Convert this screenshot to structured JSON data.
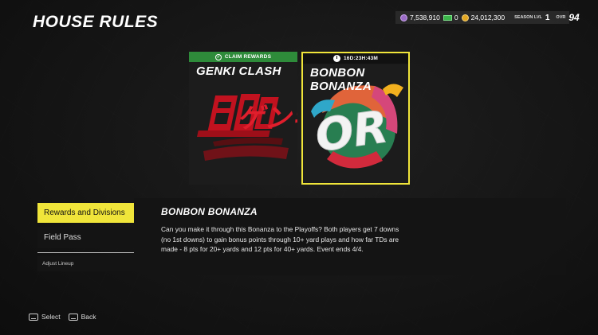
{
  "page": {
    "title": "HOUSE RULES"
  },
  "stats": {
    "coins_purple": "7,538,910",
    "cash": "0",
    "coins_gold": "24,012,300",
    "season_lvl_label": "SEASON LVL",
    "season_lvl": "1",
    "ovr_label": "OVR",
    "ovr": "94"
  },
  "cards": [
    {
      "name": "GENKI CLASH",
      "banner": "CLAIM REWARDS",
      "art_text": "ゲンキ",
      "selected": false
    },
    {
      "name": "BONBON BONANZA",
      "banner": "16D:23H:43M",
      "art_text": "OR",
      "selected": true
    }
  ],
  "menu": {
    "rewards": "Rewards and Divisions",
    "field_pass": "Field Pass",
    "adjust_lineup": "Adjust Lineup"
  },
  "detail": {
    "title": "BONBON BONANZA",
    "description": "Can you make it through this Bonanza to the Playoffs? Both players get 7 downs (no 1st downs) to gain bonus points through 10+ yard plays and how far TDs are made - 8 pts for 20+ yards and 12 pts for 40+ yards. Event ends 4/4."
  },
  "footer": {
    "select": "Select",
    "back": "Back"
  },
  "colors": {
    "accent": "#f0e53a",
    "claim_green": "#2e8b3a"
  }
}
